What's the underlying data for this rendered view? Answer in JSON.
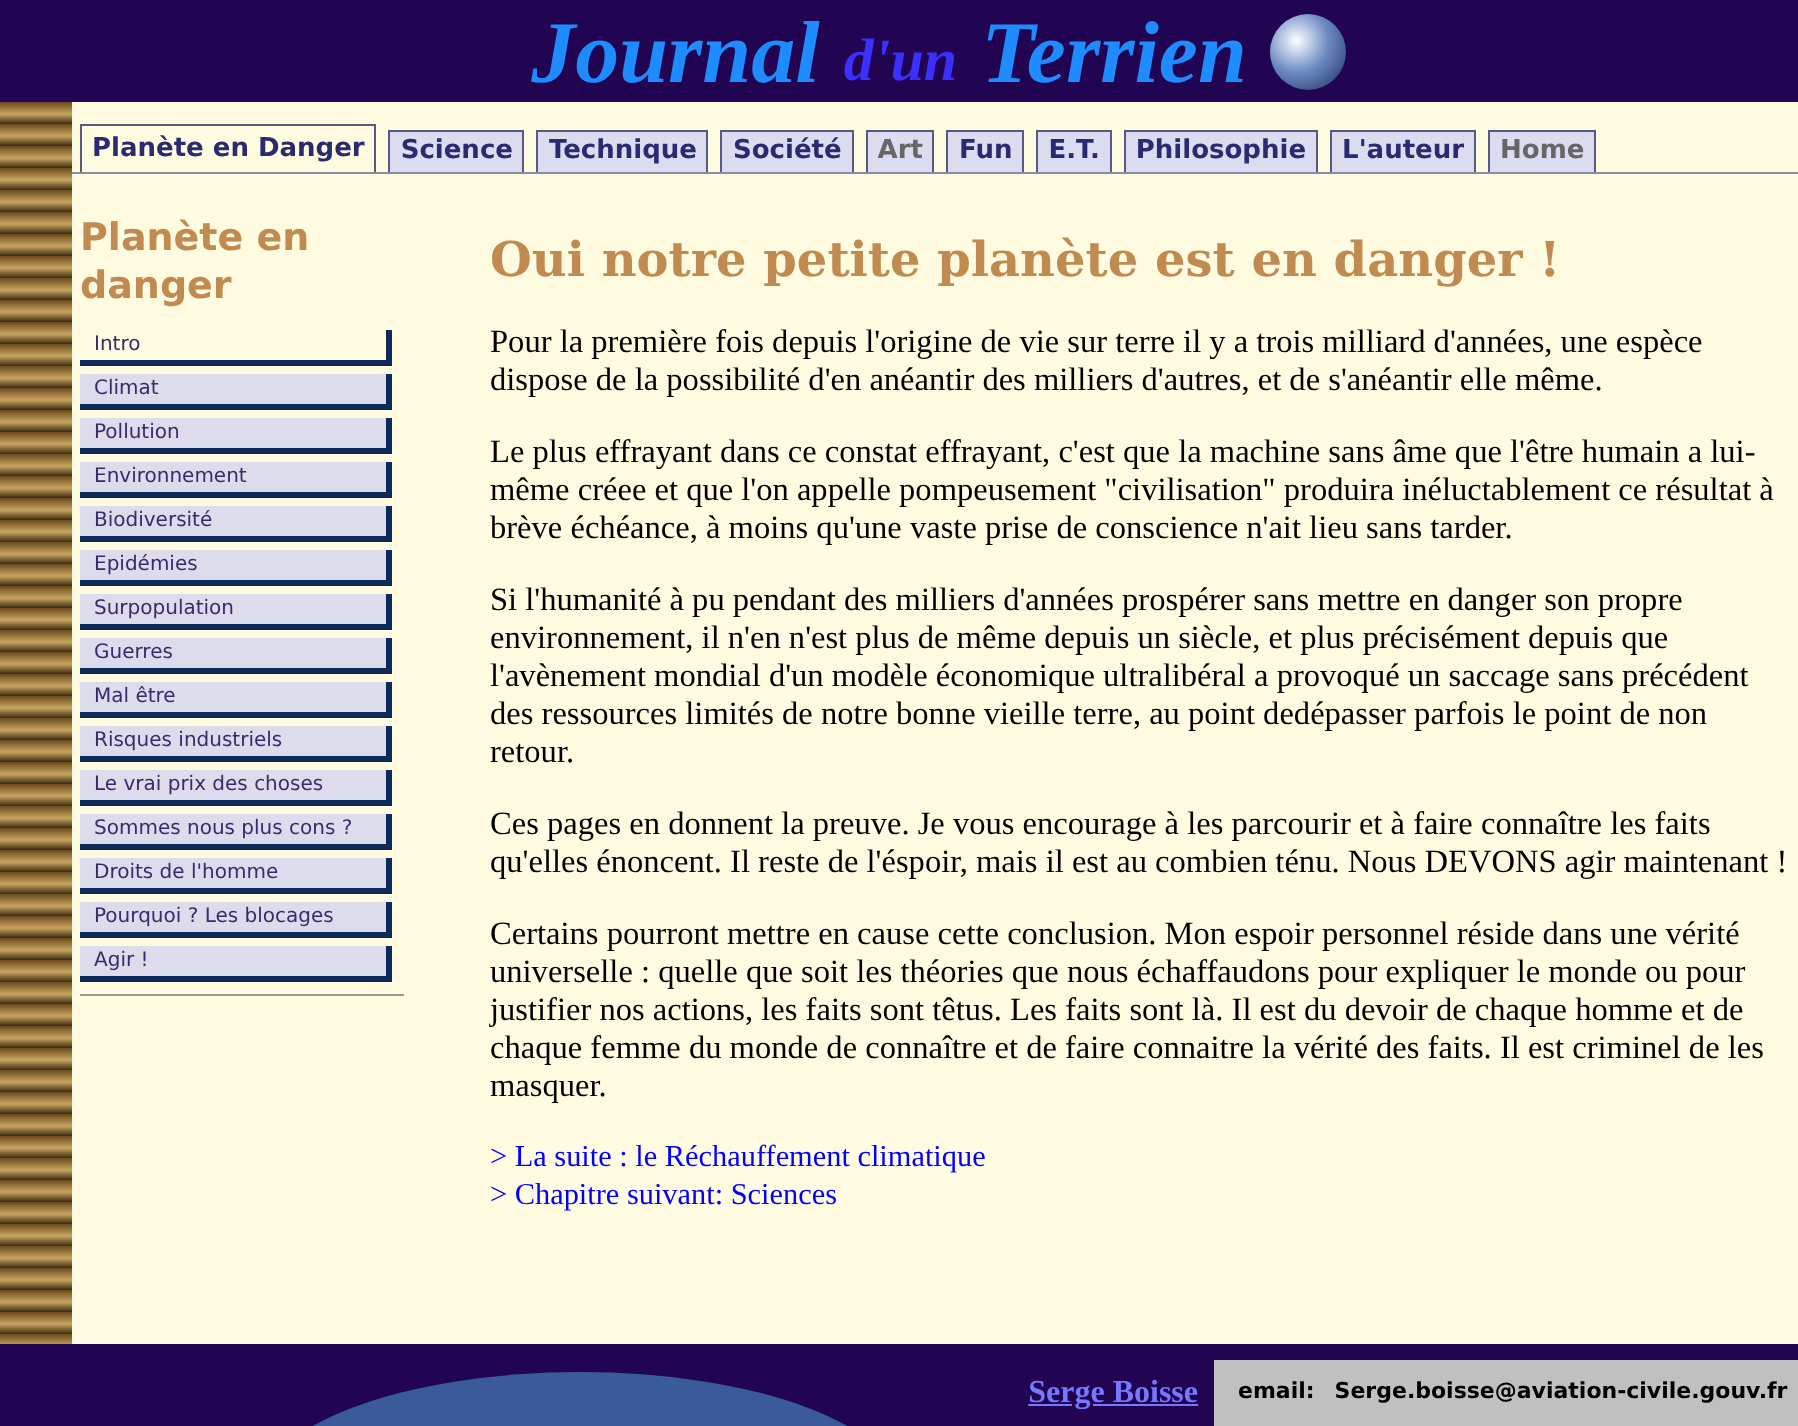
{
  "header": {
    "logo_parts": [
      "Journal",
      "d'un",
      "Terrien"
    ]
  },
  "tabs": [
    {
      "label": "Planète en Danger",
      "selected": true,
      "dimmed": false
    },
    {
      "label": "Science",
      "selected": false,
      "dimmed": false
    },
    {
      "label": "Technique",
      "selected": false,
      "dimmed": false
    },
    {
      "label": "Société",
      "selected": false,
      "dimmed": false
    },
    {
      "label": "Art",
      "selected": false,
      "dimmed": true
    },
    {
      "label": "Fun",
      "selected": false,
      "dimmed": false
    },
    {
      "label": "E.T.",
      "selected": false,
      "dimmed": false
    },
    {
      "label": "Philosophie",
      "selected": false,
      "dimmed": false
    },
    {
      "label": "L'auteur",
      "selected": false,
      "dimmed": false
    },
    {
      "label": "Home",
      "selected": false,
      "dimmed": true
    }
  ],
  "sidebar": {
    "title": "Planète en danger",
    "items": [
      {
        "label": "Intro",
        "selected": true
      },
      {
        "label": "Climat",
        "selected": false
      },
      {
        "label": "Pollution",
        "selected": false
      },
      {
        "label": "Environnement",
        "selected": false
      },
      {
        "label": "Biodiversité",
        "selected": false
      },
      {
        "label": "Epidémies",
        "selected": false
      },
      {
        "label": "Surpopulation",
        "selected": false
      },
      {
        "label": "Guerres",
        "selected": false
      },
      {
        "label": "Mal être",
        "selected": false
      },
      {
        "label": "Risques industriels",
        "selected": false
      },
      {
        "label": "Le vrai prix des choses",
        "selected": false
      },
      {
        "label": "Sommes nous plus cons ?",
        "selected": false
      },
      {
        "label": "Droits de l'homme",
        "selected": false
      },
      {
        "label": "Pourquoi ? Les blocages",
        "selected": false
      },
      {
        "label": "Agir !",
        "selected": false
      }
    ]
  },
  "article": {
    "title": "Oui notre petite planète est en danger !",
    "paragraphs": [
      "Pour la première fois depuis l'origine de vie sur terre il y a trois milliard d'années, une espèce dispose de la possibilité d'en anéantir des milliers d'autres, et de s'anéantir elle même.",
      "Le plus effrayant dans ce constat effrayant, c'est que la machine sans âme que l'être humain a lui-même créee et que l'on appelle pompeusement \"civilisation\"  produira inéluctablement ce résultat à brève échéance, à moins qu'une vaste prise de conscience n'ait lieu sans tarder.",
      "Si l'humanité à pu pendant des milliers d'années prospérer sans mettre en danger son propre environnement, il n'en n'est plus de même depuis un siècle, et plus précisément depuis que l'avènement mondial d'un modèle économique ultralibéral a provoqué un saccage sans précédent des ressources limités de notre bonne vieille terre, au point dedépasser parfois le point de non retour.",
      "Ces pages en donnent la preuve. Je vous encourage à les parcourir et à faire connaître les faits qu'elles énoncent. Il reste de l'éspoir, mais il est au combien ténu. Nous DEVONS agir maintenant !",
      "Certains pourront mettre en cause cette conclusion. Mon espoir personnel réside dans une vérité universelle : quelle que soit les théories que nous échaffaudons pour expliquer le monde ou pour justifier nos actions, les faits sont têtus.  Les faits sont là. Il est du devoir de chaque homme et de chaque femme du monde de connaître et de faire connaitre la vérité des faits. Il est criminel de les masquer."
    ],
    "links": [
      "> La suite : le Réchauffement climatique",
      "> Chapitre suivant: Sciences"
    ]
  },
  "footer": {
    "author": "Serge Boisse",
    "email_label": "email:",
    "email": "Serge.boisse@aviation-civile.gouv.fr"
  }
}
